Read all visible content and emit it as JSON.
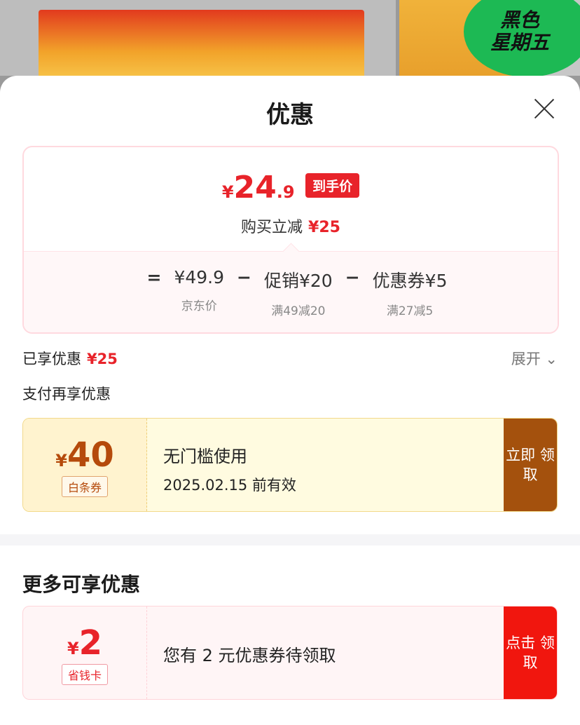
{
  "banner": {
    "badge_line1": "黑色",
    "badge_line2": "星期五"
  },
  "sheet": {
    "title": "优惠"
  },
  "price": {
    "yen": "¥",
    "int": "24",
    "dec": ".9",
    "tag": "到手价",
    "discount_label": "购买立减",
    "discount_amount": "¥25",
    "formula": {
      "eq": "=",
      "base": "¥49.9",
      "base_sub": "京东价",
      "op1": "−",
      "promo": "促销¥20",
      "promo_sub": "满49减20",
      "op2": "−",
      "coupon": "优惠券¥5",
      "coupon_sub": "满27减5"
    }
  },
  "enjoyed": {
    "label": "已享优惠",
    "amount": "¥25",
    "expand": "展开 ⌄"
  },
  "pay_more": {
    "label": "支付再享优惠"
  },
  "coupon1": {
    "yen": "¥",
    "amount": "40",
    "type": "白条券",
    "title": "无门槛使用",
    "expiry": "2025.02.15 前有效",
    "btn": "立即 领取"
  },
  "more": {
    "title": "更多可享优惠"
  },
  "coupon2": {
    "yen": "¥",
    "amount": "2",
    "type": "省钱卡",
    "title": "您有 2 元优惠券待领取",
    "btn": "点击 领取"
  },
  "colors": {
    "accent_red": "#e8232a",
    "gold_btn": "#a4510d",
    "red_btn": "#f1160e",
    "badge_green": "#1db954"
  }
}
